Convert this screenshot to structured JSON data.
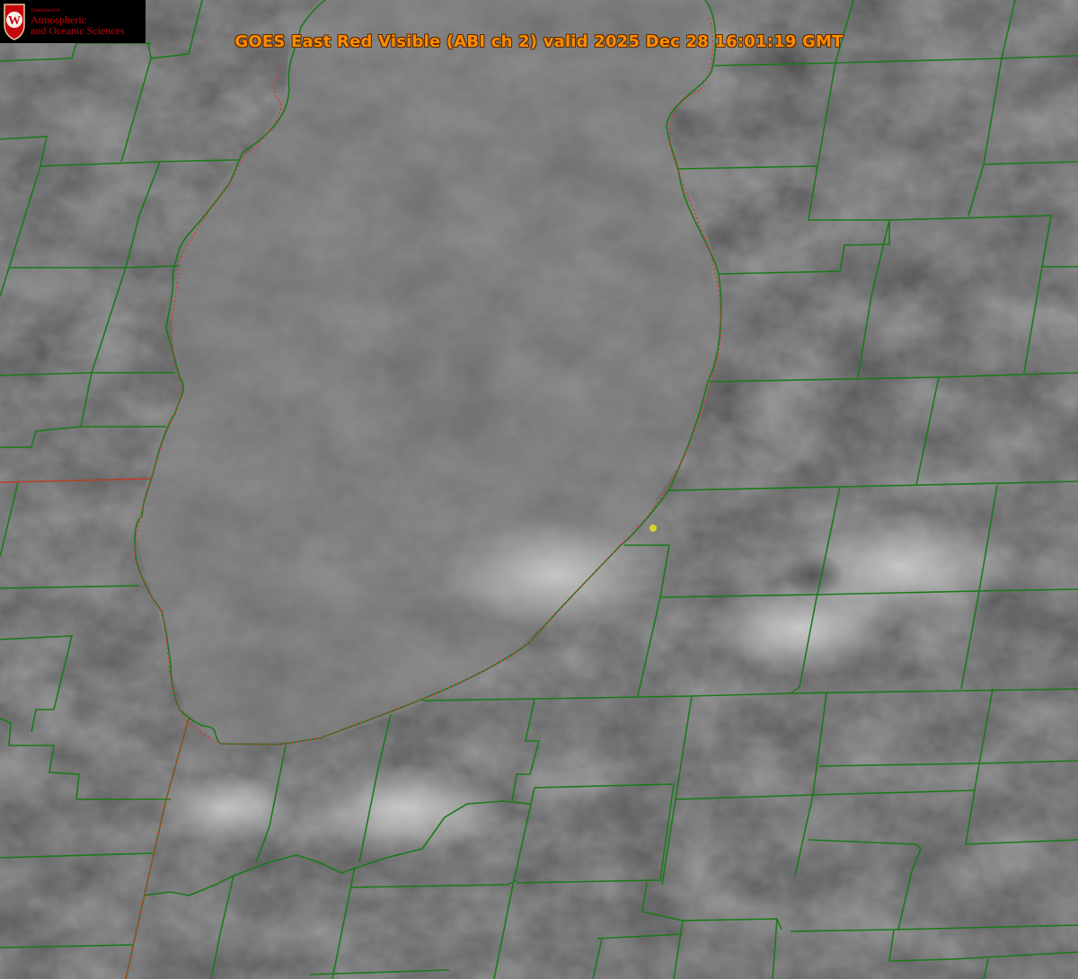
{
  "title": "GOES East Red Visible (ABI ch 2) valid 2025 Dec 28 16:01:19 GMT",
  "logo": {
    "department": "Department of",
    "line1": "Atmospheric",
    "line2": "and Oceanic Sciences",
    "crest_letter": "W",
    "color": "#c5050c"
  },
  "colors": {
    "county_lines": "#1a7a1a",
    "shoreline_dots": "#e03030",
    "title_text": "#ff8c00",
    "station_marker": "#d4d42a"
  }
}
